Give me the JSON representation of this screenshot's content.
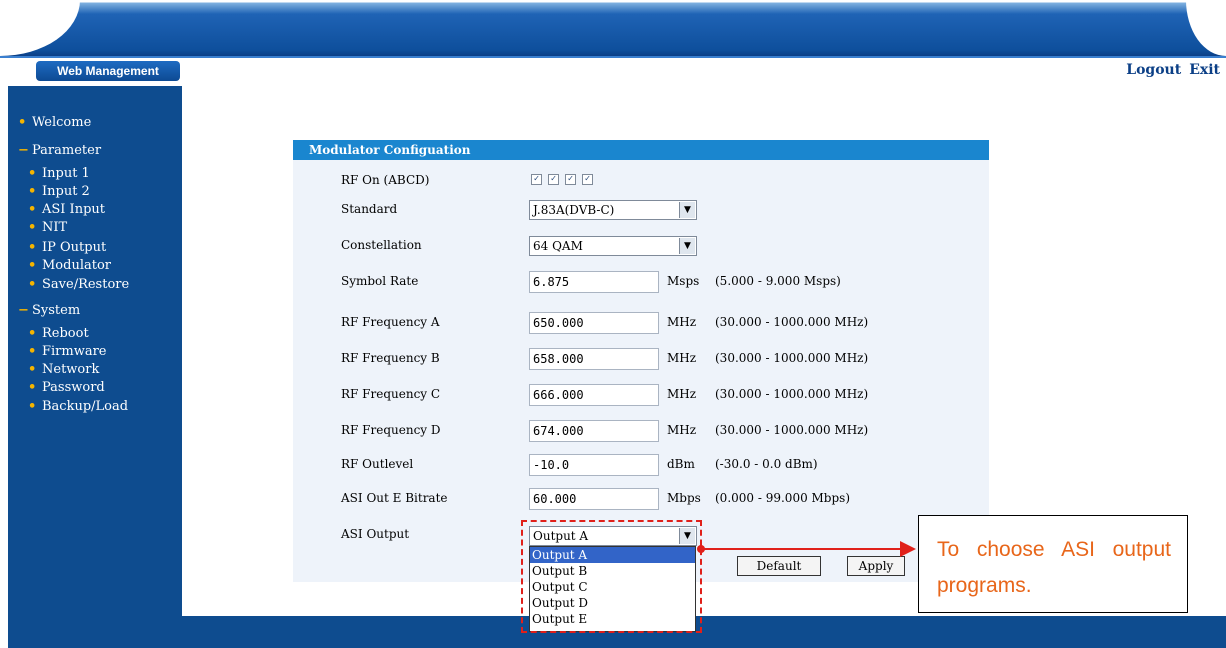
{
  "header": {
    "web_management": "Web Management",
    "logout": "Logout",
    "exit": "Exit"
  },
  "sidebar": {
    "items": [
      {
        "label": "Welcome",
        "type": "item"
      },
      {
        "label": "Parameter",
        "type": "group"
      },
      {
        "label": "Input 1",
        "type": "sub"
      },
      {
        "label": "Input 2",
        "type": "sub"
      },
      {
        "label": "ASI Input",
        "type": "sub"
      },
      {
        "label": "NIT",
        "type": "sub"
      },
      {
        "label": "IP Output",
        "type": "sub"
      },
      {
        "label": "Modulator",
        "type": "sub"
      },
      {
        "label": "Save/Restore",
        "type": "sub"
      },
      {
        "label": "System",
        "type": "group"
      },
      {
        "label": "Reboot",
        "type": "sub"
      },
      {
        "label": "Firmware",
        "type": "sub"
      },
      {
        "label": "Network",
        "type": "sub"
      },
      {
        "label": "Password",
        "type": "sub"
      },
      {
        "label": "Backup/Load",
        "type": "sub"
      }
    ]
  },
  "panel": {
    "title": "Modulator Configuation",
    "rf_on_label": "RF On (ABCD)",
    "rf_on_checked": [
      true,
      true,
      true,
      true
    ],
    "standard_label": "Standard",
    "standard_value": "J.83A(DVB-C)",
    "constellation_label": "Constellation",
    "constellation_value": "64 QAM",
    "rows": [
      {
        "label": "Symbol Rate",
        "value": "6.875",
        "unit": "Msps",
        "range": "(5.000 - 9.000 Msps)"
      },
      {
        "label": "RF Frequency A",
        "value": "650.000",
        "unit": "MHz",
        "range": "(30.000 - 1000.000 MHz)"
      },
      {
        "label": "RF Frequency B",
        "value": "658.000",
        "unit": "MHz",
        "range": "(30.000 - 1000.000 MHz)"
      },
      {
        "label": "RF Frequency C",
        "value": "666.000",
        "unit": "MHz",
        "range": "(30.000 - 1000.000 MHz)"
      },
      {
        "label": "RF Frequency D",
        "value": "674.000",
        "unit": "MHz",
        "range": "(30.000 - 1000.000 MHz)"
      },
      {
        "label": "RF Outlevel",
        "value": "-10.0",
        "unit": "dBm",
        "range": "(-30.0 - 0.0 dBm)"
      },
      {
        "label": "ASI Out E Bitrate",
        "value": "60.000",
        "unit": "Mbps",
        "range": "(0.000 - 99.000 Mbps)"
      }
    ],
    "asi_output_label": "ASI Output",
    "asi_output_value": "Output A",
    "asi_output_options": [
      "Output A",
      "Output B",
      "Output C",
      "Output D",
      "Output E"
    ],
    "default_button": "Default",
    "apply_button": "Apply"
  },
  "callout": {
    "text": "To choose ASI output programs."
  },
  "colors": {
    "sidebar_bg": "#0e4c8f",
    "panel_header": "#1a86cf",
    "annotation": "#e0201a",
    "callout_text": "#e8661a"
  }
}
